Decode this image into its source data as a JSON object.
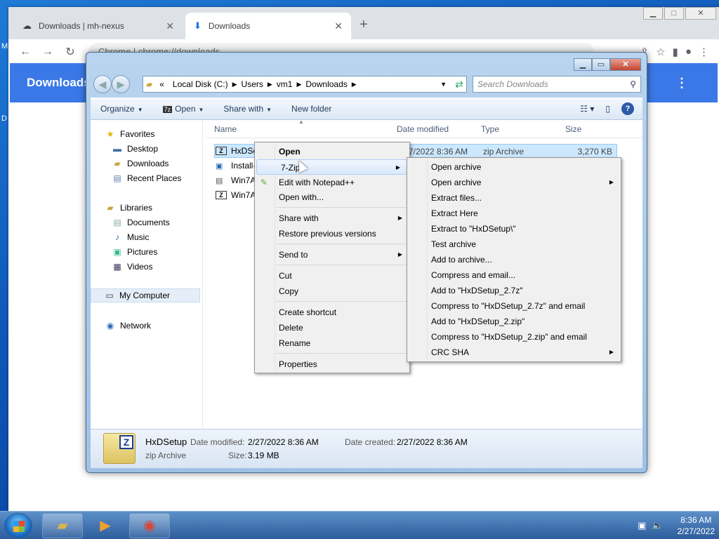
{
  "desktop": {
    "side_a": "M",
    "side_b": "D"
  },
  "chrome": {
    "tabs": [
      {
        "label": "Downloads | mh-nexus",
        "icon": "mh-nexus-icon"
      },
      {
        "label": "Downloads",
        "icon": "download-icon"
      }
    ],
    "omnibox_label": "Chrome",
    "omnibox_url": "chrome://downloads",
    "page_title": "Downloads"
  },
  "explorer": {
    "address": {
      "prefix": "«",
      "segments": [
        "Local Disk (C:)",
        "Users",
        "vm1",
        "Downloads"
      ]
    },
    "search_placeholder": "Search Downloads",
    "toolbar": {
      "organize": "Organize",
      "open": "Open",
      "share_with": "Share with",
      "new_folder": "New folder"
    },
    "nav": {
      "favorites": "Favorites",
      "fav_items": [
        "Desktop",
        "Downloads",
        "Recent Places"
      ],
      "libraries": "Libraries",
      "lib_items": [
        "Documents",
        "Music",
        "Pictures",
        "Videos"
      ],
      "computer": "My Computer",
      "network": "Network"
    },
    "columns": {
      "name": "Name",
      "date": "Date modified",
      "type": "Type",
      "size": "Size"
    },
    "files": [
      {
        "name": "HxDSe",
        "date": "7/2022 8:36 AM",
        "type": "zip Archive",
        "size": "3,270 KB"
      },
      {
        "name": "Install-"
      },
      {
        "name": "Win7A"
      },
      {
        "name": "Win7A"
      }
    ],
    "details": {
      "name": "HxDSetup",
      "type": "zip Archive",
      "modified_label": "Date modified:",
      "modified_value": "2/27/2022 8:36 AM",
      "size_label": "Size:",
      "size_value": "3.19 MB",
      "created_label": "Date created:",
      "created_value": "2/27/2022 8:36 AM"
    }
  },
  "context_menu": {
    "open": "Open",
    "zip7": "7-Zip",
    "notepad": "Edit with Notepad++",
    "open_with": "Open with...",
    "share_with": "Share with",
    "restore": "Restore previous versions",
    "send_to": "Send to",
    "cut": "Cut",
    "copy": "Copy",
    "create_shortcut": "Create shortcut",
    "delete": "Delete",
    "rename": "Rename",
    "properties": "Properties"
  },
  "zip_menu": [
    "Open archive",
    "Open archive",
    "Extract files...",
    "Extract Here",
    "Extract to \"HxDSetup\\\"",
    "Test archive",
    "Add to archive...",
    "Compress and email...",
    "Add to \"HxDSetup_2.7z\"",
    "Compress to \"HxDSetup_2.7z\" and email",
    "Add to \"HxDSetup_2.zip\"",
    "Compress to \"HxDSetup_2.zip\" and email",
    "CRC SHA"
  ],
  "taskbar": {
    "time": "8:36 AM",
    "date": "2/27/2022"
  }
}
